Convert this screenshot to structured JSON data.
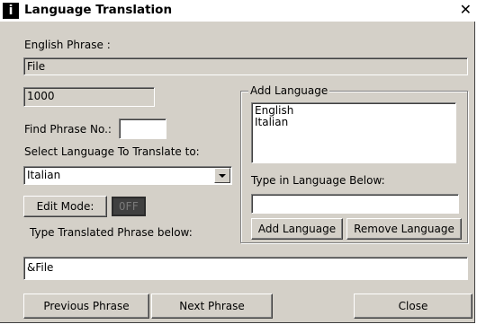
{
  "window": {
    "title": "Language Translation",
    "icon_glyph": "i",
    "close_glyph": "✕"
  },
  "english_phrase": {
    "label": "English Phrase :",
    "value": "File"
  },
  "phrase_number": {
    "value": "1000"
  },
  "find_phrase": {
    "label": "Find Phrase No.:",
    "value": ""
  },
  "select_language": {
    "label": "Select Language To Translate to:",
    "selected": "Italian"
  },
  "edit_mode": {
    "button_label": "Edit Mode:",
    "state": "OFF"
  },
  "translated_phrase": {
    "label": "Type Translated Phrase below:",
    "value": "&File"
  },
  "add_language_group": {
    "title": "Add Language",
    "languages": [
      "English",
      "Italian"
    ],
    "type_label": "Type in Language Below:",
    "input_value": "",
    "add_button": "Add Language",
    "remove_button": "Remove Language"
  },
  "footer": {
    "previous_button": "Previous Phrase",
    "next_button": "Next Phrase",
    "close_button": "Close"
  },
  "colors": {
    "dialog_bg": "#d4d0c8",
    "indicator_bg": "#404040"
  }
}
